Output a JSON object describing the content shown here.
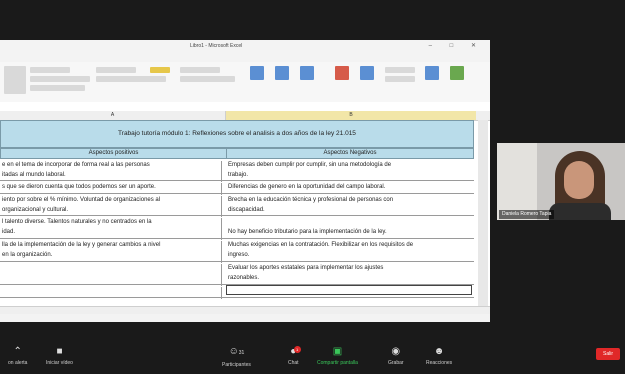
{
  "excel": {
    "window_title": "Libro1 - Microsoft Excel",
    "column_a": "A",
    "column_b": "B",
    "table_title": "Trabajo tutoría módulo 1: Reflexiones sobre el analisis a dos años de la ley 21.015",
    "header_positive": "Aspectos positivos",
    "header_negative": "Aspectos Negativos",
    "rows": [
      {
        "a": "e en el tema de incorporar de forma real a las personas\nitadas al mundo laboral.",
        "b": "Empresas deben cumplir por cumplir, sin una metodología de\ntrabajo."
      },
      {
        "a": "s que se dieron cuenta que todos podemos ser un aporte.",
        "b": "Diferencias de genero en la oportunidad del campo laboral."
      },
      {
        "a": "iento por sobre el % mínimo. Voluntad de organizaciones al\norganizacional y cultural.",
        "b": "Brecha en la educación técnica y profesional de personas con\ndiscapacidad."
      },
      {
        "a": "l talento diverse. Talentos naturales y no centrados en la\nidad.",
        "b": "\nNo hay beneficio tributario para la implementación de la ley."
      },
      {
        "a": "lla de la implementación de la ley y generar cambios a nivel\nen la organización.",
        "b": "Muchas exigencias en la contratación. Flexibilizar en los requisitos de\ningreso."
      },
      {
        "a": "",
        "b": "Evaluar los aportes estatales para implementar los ajustes\nrazonables."
      },
      {
        "a": "",
        "b": ""
      }
    ]
  },
  "participant": {
    "name": "Daniela Romero Tapia"
  },
  "toolbar": {
    "stop_video": "Iniciar vídeo",
    "participants": "Participantes",
    "participants_count": "31",
    "chat": "Chat",
    "chat_badge": "1",
    "share_screen": "Compartir pantalla",
    "record": "Grabar",
    "reactions": "Reacciones",
    "leave": "Salir",
    "mute": "on alerta"
  }
}
